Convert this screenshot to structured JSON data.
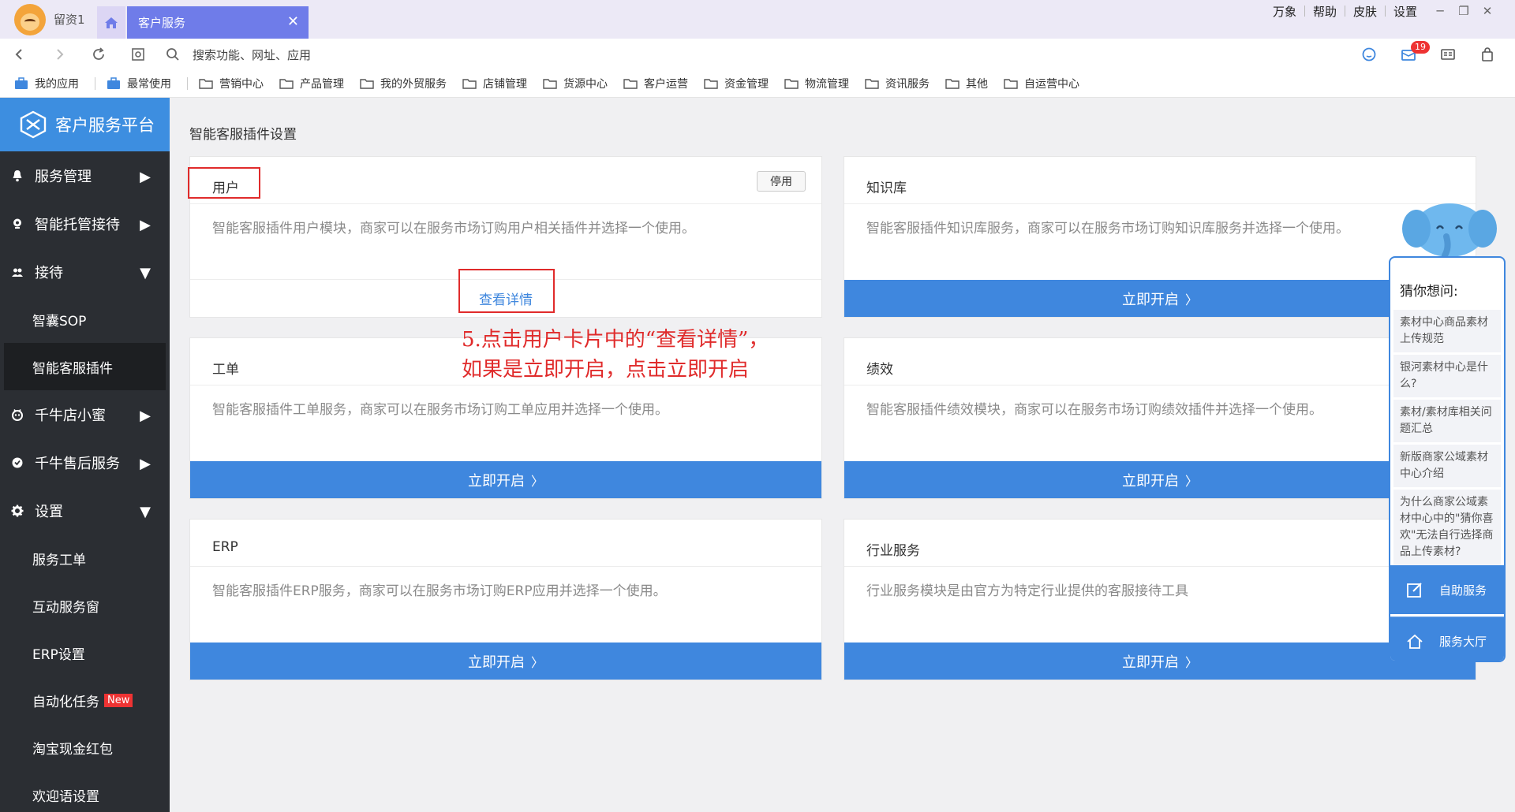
{
  "tabbar": {
    "user_name": "留资1",
    "active_tab": "客户服务",
    "close_glyph": "✕",
    "top_links": [
      "万象",
      "帮助",
      "皮肤",
      "设置"
    ]
  },
  "addressbar": {
    "search_placeholder": "搜索功能、网址、应用",
    "message_badge": "19"
  },
  "bookmarks": [
    "我的应用",
    "最常使用",
    "营销中心",
    "产品管理",
    "我的外贸服务",
    "店铺管理",
    "货源中心",
    "客户运营",
    "资金管理",
    "物流管理",
    "资讯服务",
    "其他",
    "自运营中心"
  ],
  "sidebar": {
    "brand": "客户服务平台",
    "items": [
      {
        "label": "服务管理",
        "icon": "bell-icon",
        "arrow": "▶"
      },
      {
        "label": "智能托管接待",
        "icon": "location-icon",
        "arrow": "▶"
      },
      {
        "label": "接待",
        "icon": "users-icon",
        "arrow": "▼"
      },
      {
        "label": "智囊SOP"
      },
      {
        "label": "智能客服插件"
      },
      {
        "label": "千牛店小蜜",
        "icon": "robot-icon",
        "arrow": "▶"
      },
      {
        "label": "千牛售后服务",
        "icon": "shield-icon",
        "arrow": "▶"
      },
      {
        "label": "设置",
        "icon": "gear-icon",
        "arrow": "▼"
      },
      {
        "label": "服务工单"
      },
      {
        "label": "互动服务窗"
      },
      {
        "label": "ERP设置"
      },
      {
        "label": "自动化任务",
        "tag": "New"
      },
      {
        "label": "淘宝现金红包"
      },
      {
        "label": "欢迎语设置"
      }
    ]
  },
  "main": {
    "page_title": "智能客服插件设置",
    "cards": [
      {
        "title": "用户",
        "desc": "智能客服插件用户模块，商家可以在服务市场订购用户相关插件并选择一个使用。",
        "stop_label": "停用",
        "detail_label": "查看详情"
      },
      {
        "title": "知识库",
        "desc": "智能客服插件知识库服务，商家可以在服务市场订购知识库服务并选择一个使用。",
        "button": "立即开启"
      },
      {
        "title": "工单",
        "desc": "智能客服插件工单服务，商家可以在服务市场订购工单应用并选择一个使用。",
        "button": "立即开启"
      },
      {
        "title": "绩效",
        "desc": "智能客服插件绩效模块，商家可以在服务市场订购绩效插件并选择一个使用。",
        "button": "立即开启"
      },
      {
        "title": "ERP",
        "desc": "智能客服插件ERP服务，商家可以在服务市场订购ERP应用并选择一个使用。",
        "button": "立即开启"
      },
      {
        "title": "行业服务",
        "desc": "行业服务模块是由官方为特定行业提供的客服接待工具",
        "button": "立即开启"
      }
    ],
    "annotation_line1": "5.点击用户卡片中的“查看详情”，",
    "annotation_line2": "如果是立即开启，点击立即开启"
  },
  "help": {
    "title": "猜你想问:",
    "questions": [
      "素材中心商品素材上传规范",
      "银河素材中心是什么?",
      "素材/素材库相关问题汇总",
      "新版商家公域素材中心介绍",
      "为什么商家公域素材中心中的\"猜你喜欢\"无法自行选择商品上传素材?"
    ],
    "self_service": "自助服务",
    "service_hall": "服务大厅"
  },
  "colors": {
    "accent": "#3f87de",
    "sidebar_bg": "#2b2e33",
    "tab_active": "#6f7ce9",
    "annotation": "#e02b2b"
  }
}
